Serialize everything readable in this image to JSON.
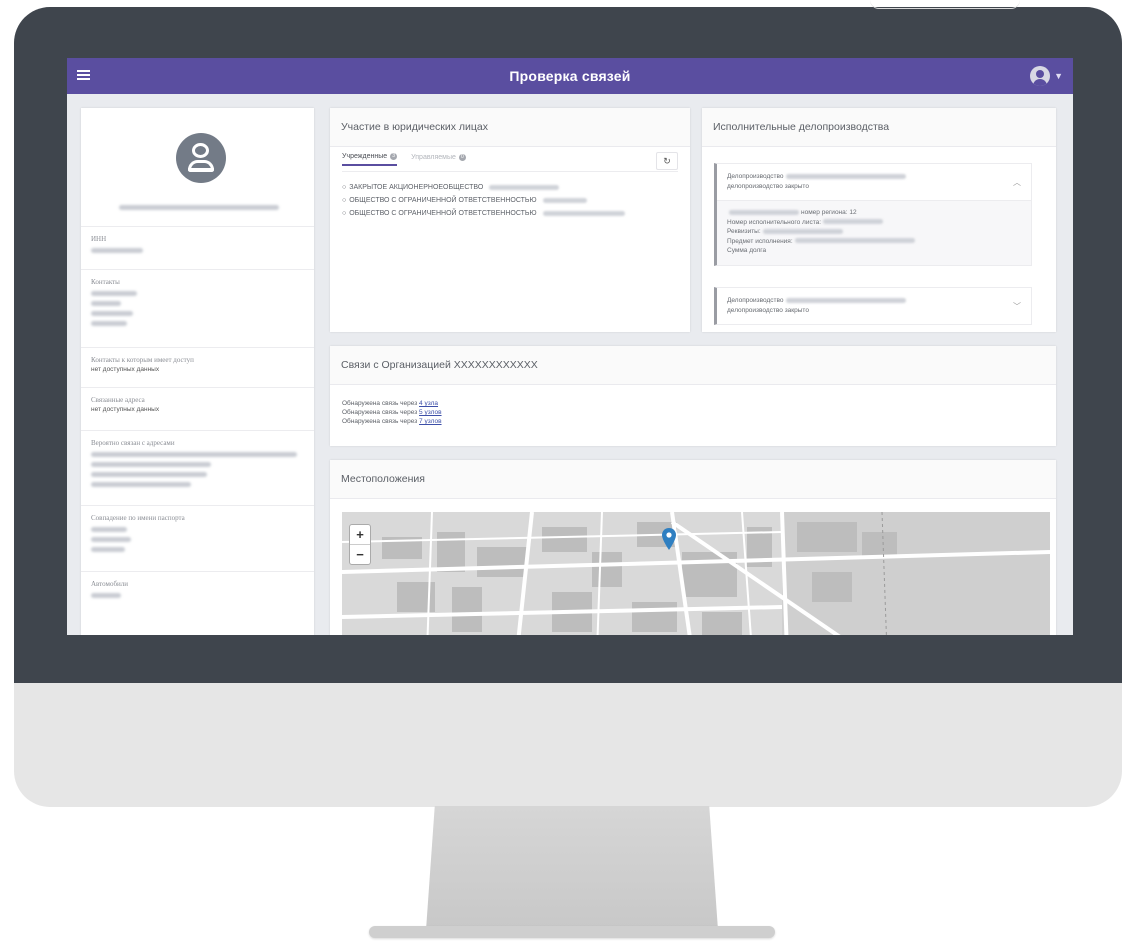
{
  "header": {
    "title": "Проверка связей"
  },
  "profile": {
    "sections": [
      {
        "label": "ИНН"
      },
      {
        "label": "Контакты"
      },
      {
        "label": "Контакты к которым имеет доступ",
        "value": "нет доступных данных"
      },
      {
        "label": "Связанные адреса",
        "value": "нет доступных данных"
      },
      {
        "label": "Вероятно связан с адресами"
      },
      {
        "label": "Совпадение по имени паспорта"
      },
      {
        "label": "Автомобили"
      }
    ]
  },
  "participation": {
    "title": "Участие в юридических лицах",
    "tabs": [
      {
        "label": "Учрежденные",
        "count": "3"
      },
      {
        "label": "Управляемые",
        "count": "0"
      }
    ],
    "reload_icon": "↻",
    "orgs": [
      "ЗАКРЫТОЕ АКЦИОНЕРНОЕОБЩЕСТВО",
      "ОБЩЕСТВО С ОГРАНИЧЕННОЙ ОТВЕТСТВЕННОСТЬЮ",
      "ОБЩЕСТВО С ОГРАНИЧЕННОЙ ОТВЕТСТВЕННОСТЬЮ"
    ]
  },
  "enforcement": {
    "title": "Исполнительные делопроизводства",
    "items": [
      {
        "label": "Делопроизводство",
        "status": "делопроизводство закрыто",
        "details": [
          "номер региона: 12",
          "Номер исполнительного листа:",
          "Реквизиты:",
          "Предмет исполнения:",
          "Сумма долга"
        ]
      },
      {
        "label": "Делопроизводство",
        "status": "делопроизводство закрыто"
      }
    ]
  },
  "connections": {
    "title": "Связи с Организацией XXXXXXXXXXXX",
    "prefix": "Обнаружена связь через",
    "links": [
      "4 узла",
      "5 узлов",
      "7 узлов"
    ]
  },
  "locations": {
    "title": "Местоположения",
    "zoom_in": "+",
    "zoom_out": "−",
    "marker_color": "#2f7fc1"
  },
  "colors": {
    "accent": "#5a4ea0",
    "bezel": "#3f454d"
  }
}
